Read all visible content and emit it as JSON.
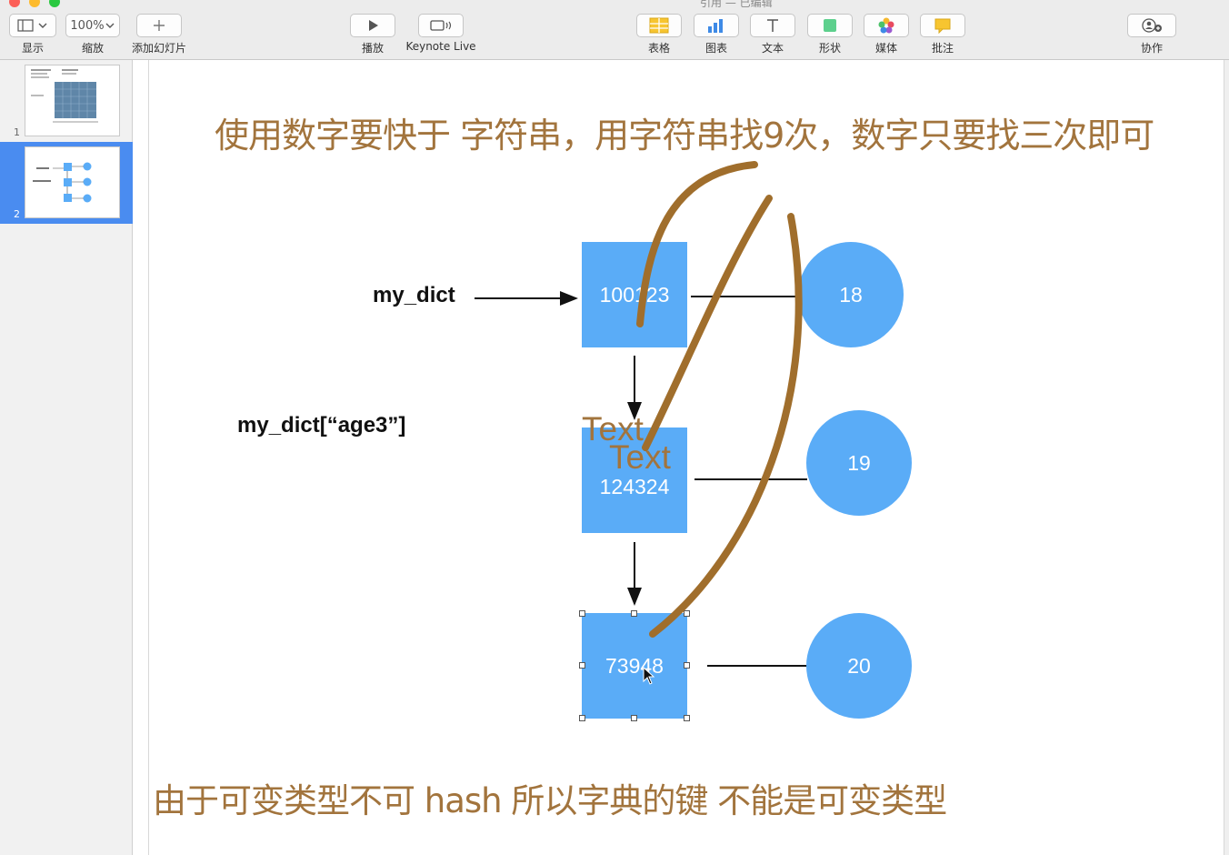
{
  "window": {
    "title": "引用 — 已编辑"
  },
  "toolbar": {
    "view_label": "显示",
    "zoom_value": "100%",
    "zoom_label": "缩放",
    "add_slide_label": "添加幻灯片",
    "play_label": "播放",
    "keynote_live_label": "Keynote Live",
    "table_label": "表格",
    "chart_label": "图表",
    "text_label": "文本",
    "shape_label": "形状",
    "media_label": "媒体",
    "comment_label": "批注",
    "collaborate_label": "协作"
  },
  "sidebar": {
    "slides": [
      {
        "number": "1",
        "selected": false
      },
      {
        "number": "2",
        "selected": true
      }
    ]
  },
  "slide": {
    "heading": "使用数字要快于 字符串，用字符串找9次，数字只要找三次即可",
    "footer": "由于可变类型不可 hash 所以字典的键 不能是可变类型",
    "label_my_dict": "my_dict",
    "label_lookup": "my_dict[“age3”]",
    "keys": [
      "100123",
      "124324",
      "73948"
    ],
    "values": [
      "18",
      "19",
      "20"
    ],
    "placeholder_text_1": "Text",
    "placeholder_text_2": "Text"
  },
  "colors": {
    "accent_blue": "#5aacf7",
    "annotation_brown": "#a2743d",
    "selection_blue": "#4a8cf0"
  }
}
